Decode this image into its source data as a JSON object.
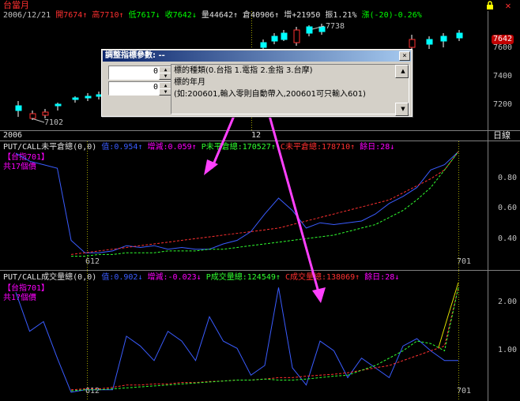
{
  "top_panel": {
    "title": "台當月",
    "lock_icon": "lock-icon",
    "date": "2006/12/21",
    "open": "開7674",
    "high": "高7710",
    "low": "低7617",
    "close": "收7642",
    "volume": "量44642",
    "oi": "倉40906",
    "change": "增+21950",
    "amplitude": "振1.21%",
    "rise": "漲(-20)-0.26%",
    "price_tag": "7642",
    "annot_high": "7738",
    "annot_low": "7102",
    "axis_labels": [
      "7600",
      "7400",
      "7200"
    ],
    "date_labels": [
      "2006",
      "12"
    ],
    "corner_label": "日線"
  },
  "panel1": {
    "title": "PUT/CALL未平倉總(0,0)",
    "value": "值:0.954",
    "delta": "增減:0.059",
    "p_total": "P未平倉總:170527",
    "c_total": "C未平倉總:178710",
    "days_left": "餘日:28",
    "legend1": "【台指701】",
    "legend2": "共17個價",
    "axis_labels": [
      "0.80",
      "0.60",
      "0.40"
    ],
    "marker_left": "612",
    "marker_right": "701"
  },
  "panel2": {
    "title": "PUT/CALL成交量總(0,0)",
    "value": "值:0.902",
    "delta": "增減:-0.023",
    "p_total": "P成交量總:124549",
    "c_total": "C成交量總:138069",
    "days_left": "餘日:28",
    "legend1": "【台指701】",
    "legend2": "共17個價",
    "axis_labels": [
      "2.00",
      "1.00"
    ],
    "marker_left": "612",
    "marker_right": "701"
  },
  "dialog": {
    "title": "調整指標參數: --",
    "close_label": "×",
    "param1_value": "0",
    "param2_value": "0",
    "lines": [
      "標的種類(0.台指 1.電指 2.金指 3.台摩)",
      "標的年月",
      "(如:200601,輸入零則自動帶入,200601可只輸入601)"
    ]
  },
  "colors": {
    "blue_series": "#3a5cff",
    "red_series": "#ff3030",
    "green_series": "#30ff30",
    "yellow_series": "#e0e000",
    "magenta": "#ff00ff",
    "arrow": "#ff40ff"
  },
  "chart_data": [
    {
      "type": "line",
      "title": "PUT/CALL未平倉總(0,0)",
      "ylim": [
        0.3,
        0.95
      ],
      "series": [
        {
          "values": [
            0.945,
            0.9,
            0.88,
            0.86,
            0.45,
            0.38,
            0.38,
            0.39,
            0.42,
            0.41,
            0.42,
            0.4,
            0.41,
            0.4,
            0.4,
            0.43,
            0.45,
            0.5,
            0.6,
            0.69,
            0.62,
            0.52,
            0.55,
            0.54,
            0.55,
            0.56,
            0.6,
            0.66,
            0.7,
            0.75,
            0.85,
            0.88,
            0.954
          ]
        },
        {
          "values": [
            null,
            null,
            null,
            null,
            0.37,
            0.38,
            0.39,
            0.4,
            0.41,
            0.42,
            0.43,
            0.44,
            0.45,
            0.46,
            0.47,
            0.48,
            0.49,
            0.5,
            0.51,
            0.52,
            0.54,
            0.56,
            0.58,
            0.6,
            0.62,
            0.64,
            0.66,
            0.68,
            0.72,
            0.76,
            0.8,
            0.85,
            0.954
          ]
        },
        {
          "values": [
            null,
            null,
            null,
            null,
            0.36,
            0.36,
            0.37,
            0.37,
            0.38,
            0.38,
            0.38,
            0.39,
            0.39,
            0.39,
            0.4,
            0.4,
            0.41,
            0.42,
            0.43,
            0.44,
            0.45,
            0.46,
            0.47,
            0.48,
            0.5,
            0.52,
            0.54,
            0.58,
            0.62,
            0.68,
            0.75,
            0.85,
            0.954
          ]
        }
      ]
    },
    {
      "type": "line",
      "title": "PUT/CALL成交量總(0,0)",
      "ylim": [
        0.2,
        2.5
      ],
      "series": [
        {
          "values": [
            2.3,
            1.5,
            1.7,
            0.95,
            0.25,
            0.3,
            0.3,
            0.3,
            1.4,
            1.2,
            0.9,
            1.5,
            1.3,
            0.9,
            1.8,
            1.3,
            1.15,
            0.6,
            0.8,
            2.4,
            0.75,
            0.4,
            1.3,
            1.1,
            0.55,
            0.95,
            0.75,
            0.55,
            1.2,
            1.35,
            1.1,
            0.9,
            0.902
          ]
        },
        {
          "values": [
            null,
            null,
            null,
            null,
            0.3,
            0.32,
            0.32,
            0.35,
            0.4,
            0.4,
            0.42,
            0.42,
            0.45,
            0.45,
            0.47,
            0.48,
            0.5,
            0.5,
            0.52,
            0.55,
            0.55,
            0.58,
            0.6,
            0.62,
            0.65,
            0.7,
            0.75,
            0.8,
            0.9,
            1.0,
            1.1,
            1.2,
            2.4
          ]
        },
        {
          "values": [
            null,
            null,
            null,
            null,
            0.28,
            0.3,
            0.3,
            0.32,
            0.34,
            0.36,
            0.38,
            0.4,
            0.42,
            0.44,
            0.46,
            0.48,
            0.5,
            0.5,
            0.52,
            0.5,
            0.5,
            0.52,
            0.55,
            0.58,
            0.6,
            0.7,
            0.8,
            0.95,
            1.1,
            1.3,
            1.25,
            1.1,
            2.4
          ]
        }
      ]
    }
  ]
}
